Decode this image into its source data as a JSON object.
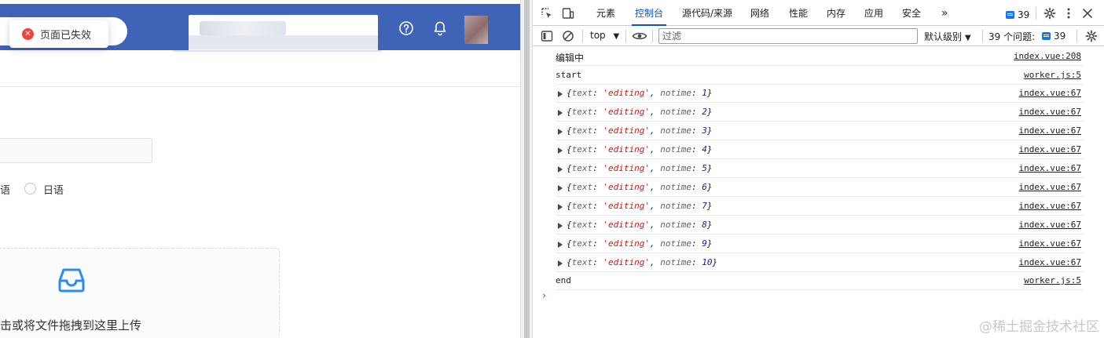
{
  "app": {
    "toast": {
      "text": "页面已失效",
      "icon": "error-circle-icon",
      "color": "#e8463f"
    },
    "header": {
      "bg_color": "#3f63b6",
      "help_icon": "question-circle-icon",
      "bell_icon": "bell-icon"
    },
    "form": {
      "radio_fragment": "语",
      "radio_option": "日语",
      "upload_text": "击或将文件拖拽到这里上传",
      "upload_icon": "inbox-icon",
      "accent_color": "#2d8cf0"
    }
  },
  "devtools": {
    "tabs": [
      {
        "label": "元素",
        "active": false
      },
      {
        "label": "控制台",
        "active": true
      },
      {
        "label": "源代码/来源",
        "active": false
      },
      {
        "label": "网络",
        "active": false
      },
      {
        "label": "性能",
        "active": false
      },
      {
        "label": "内存",
        "active": false
      },
      {
        "label": "应用",
        "active": false
      },
      {
        "label": "安全",
        "active": false
      }
    ],
    "more_tabs": "»",
    "issue_badge_count": "39",
    "toolbar": {
      "context": "top",
      "filter_placeholder": "过滤",
      "level": "默认级别",
      "issues_text": "39 个问题:",
      "issues_badge": "39"
    },
    "logs": [
      {
        "type": "text",
        "text": "编辑中",
        "source": "index.vue:208"
      },
      {
        "type": "text",
        "text": "start",
        "source": "worker.js:5"
      },
      {
        "type": "object",
        "text_value": "'editing'",
        "notime": "1",
        "source": "index.vue:67"
      },
      {
        "type": "object",
        "text_value": "'editing'",
        "notime": "2",
        "source": "index.vue:67"
      },
      {
        "type": "object",
        "text_value": "'editing'",
        "notime": "3",
        "source": "index.vue:67"
      },
      {
        "type": "object",
        "text_value": "'editing'",
        "notime": "4",
        "source": "index.vue:67"
      },
      {
        "type": "object",
        "text_value": "'editing'",
        "notime": "5",
        "source": "index.vue:67"
      },
      {
        "type": "object",
        "text_value": "'editing'",
        "notime": "6",
        "source": "index.vue:67"
      },
      {
        "type": "object",
        "text_value": "'editing'",
        "notime": "7",
        "source": "index.vue:67"
      },
      {
        "type": "object",
        "text_value": "'editing'",
        "notime": "8",
        "source": "index.vue:67"
      },
      {
        "type": "object",
        "text_value": "'editing'",
        "notime": "9",
        "source": "index.vue:67"
      },
      {
        "type": "object",
        "text_value": "'editing'",
        "notime": "10",
        "source": "index.vue:67"
      },
      {
        "type": "text",
        "text": "end",
        "source": "worker.js:5"
      }
    ],
    "prompt_symbol": "›",
    "watermark": "@稀土掘金技术社区"
  }
}
